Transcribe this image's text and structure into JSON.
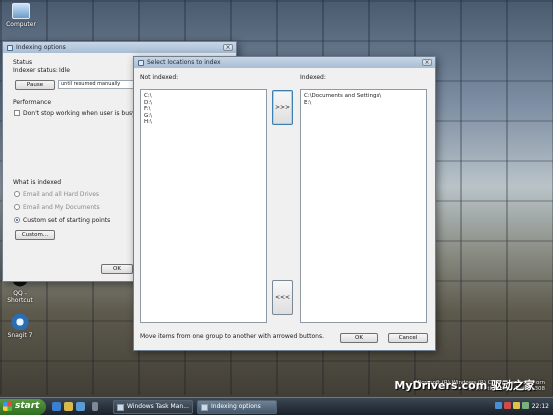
{
  "desktop": {
    "icons": [
      {
        "label": "Computer"
      },
      {
        "label": "QQ - Shortcut"
      },
      {
        "label": "Snagit 7"
      }
    ],
    "watermark_line1": "Microsoft (R) Windows (R) Codename Longhorn",
    "watermark_line2": "Evaluation copy. Build 5308",
    "site_mark": "MyDrivers.com 驱动之家"
  },
  "indexing_options": {
    "title": "Indexing options",
    "status_heading": "Status",
    "indexer_status_label": "Indexer status:",
    "indexer_status_value": "Idle",
    "pause_button": "Pause",
    "resume_field": "until resumed manually",
    "performance_heading": "Performance",
    "dont_stop_label": "Don't stop working when user is busy",
    "what_is_indexed_heading": "What is indexed",
    "option_email_all": "Email and all Hard Drives",
    "option_email_my_docs": "Email and My Documents",
    "option_custom": "Custom set of starting points",
    "custom_button": "Custom...",
    "ok_button": "OK"
  },
  "select_locations": {
    "title": "Select locations to index",
    "not_indexed_label": "Not indexed:",
    "indexed_label": "Indexed:",
    "not_indexed_items": [
      "C:\\",
      "D:\\",
      "F:\\",
      "G:\\",
      "H:\\"
    ],
    "indexed_items": [
      "C:\\Documents and Settings\\",
      "E:\\"
    ],
    "add_button": ">>>",
    "remove_button": "<<<",
    "hint": "Move items from one group to another with arrowed buttons.",
    "ok_button": "OK",
    "cancel_button": "Cancel"
  },
  "taskbar": {
    "start_label": "start",
    "tasks": [
      {
        "label": "Windows Task Man..."
      },
      {
        "label": "Indexing options"
      }
    ],
    "clock": "22:12"
  }
}
